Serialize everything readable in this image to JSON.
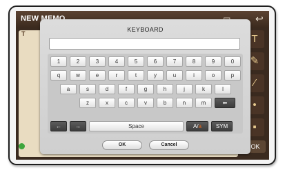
{
  "app": {
    "title": "NEW MEMO",
    "memo_prefix": "T",
    "side_ok_label": "OK",
    "icons": {
      "back": "back-arrow-icon",
      "save": "save-icon",
      "edit": "pencil-icon",
      "brush": "brush-icon",
      "color": "color-palette-icon"
    }
  },
  "keyboard": {
    "title": "KEYBOARD",
    "input_value": "",
    "rows": [
      [
        "1",
        "2",
        "3",
        "4",
        "5",
        "6",
        "7",
        "8",
        "9",
        "0"
      ],
      [
        "q",
        "w",
        "e",
        "r",
        "t",
        "y",
        "u",
        "i",
        "o",
        "p"
      ],
      [
        "a",
        "s",
        "d",
        "f",
        "g",
        "h",
        "j",
        "k",
        "l"
      ],
      [
        "z",
        "x",
        "c",
        "v",
        "b",
        "n",
        "m"
      ]
    ],
    "backspace": "backspace-icon",
    "left_arrow": "←",
    "right_arrow": "→",
    "space_label": "Space",
    "case_label_a": "A/",
    "case_label_b": "a",
    "sym_label": "SYM",
    "ok_label": "OK",
    "cancel_label": "Cancel"
  },
  "colors": {
    "app_bg": "#3a2a1f",
    "keyboard_bg": "#d6d6d6",
    "accent": "#e0661c"
  }
}
